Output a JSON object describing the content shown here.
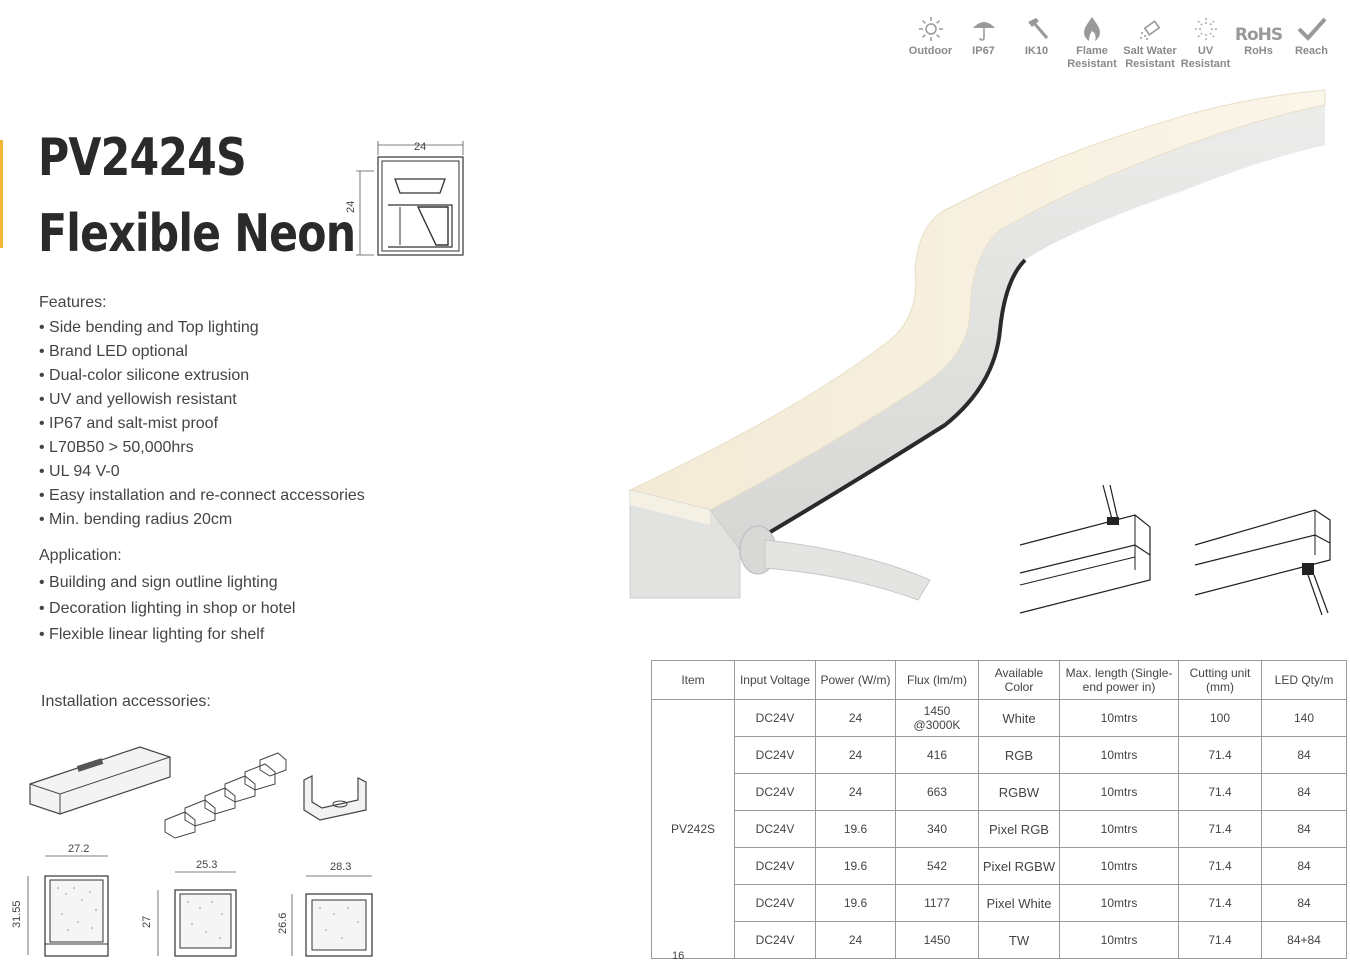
{
  "header": {
    "title_line1": "PV2424S",
    "title_line2": "Flexible Neon"
  },
  "cross_section": {
    "width_label": "24",
    "height_label": "24"
  },
  "certifications": [
    {
      "name": "sun-icon",
      "label": "Outdoor"
    },
    {
      "name": "umbrella-icon",
      "label": "IP67"
    },
    {
      "name": "hammer-icon",
      "label": "IK10"
    },
    {
      "name": "flame-icon",
      "label": "Flame Resistant"
    },
    {
      "name": "salt-spray-icon",
      "label": "Salt Water Resistant"
    },
    {
      "name": "uv-icon",
      "label": "UV Resistant"
    },
    {
      "name": "rohs-icon",
      "label": "RoHs",
      "glyph": "RoHS"
    },
    {
      "name": "checkmark-icon",
      "label": "Reach"
    }
  ],
  "features": {
    "heading": "Features:",
    "items": [
      "Side bending and Top lighting",
      "Brand LED optional",
      "Dual-color silicone extrusion",
      "UV and yellowish resistant",
      "IP67 and salt-mist proof",
      "L70B50 > 50,000hrs",
      "UL 94 V-0",
      "Easy installation and re-connect accessories",
      "Min. bending radius 20cm"
    ]
  },
  "application": {
    "heading": "Application:",
    "items": [
      "Building and sign outline lighting",
      "Decoration lighting in shop or hotel",
      "Flexible linear lighting for shelf"
    ]
  },
  "accessories": {
    "heading": "Installation accessories:",
    "profiles": [
      {
        "width": "27.2",
        "height": "31.55"
      },
      {
        "width": "25.3",
        "height": "27"
      },
      {
        "width": "28.3",
        "height": "26.6"
      }
    ]
  },
  "spec_table": {
    "headers": [
      "Item",
      "Input Voltage",
      "Power (W/m)",
      "Flux (lm/m)",
      "Available Color",
      "Max. length (Single-end power in)",
      "Cutting unit (mm)",
      "LED Qty/m"
    ],
    "item": "PV242S",
    "rows": [
      {
        "voltage": "DC24V",
        "power": "24",
        "flux": "1450 @3000K",
        "color": "White",
        "length": "10mtrs",
        "cut": "100",
        "qty": "140"
      },
      {
        "voltage": "DC24V",
        "power": "24",
        "flux": "416",
        "color": "RGB",
        "length": "10mtrs",
        "cut": "71.4",
        "qty": "84"
      },
      {
        "voltage": "DC24V",
        "power": "24",
        "flux": "663",
        "color": "RGBW",
        "length": "10mtrs",
        "cut": "71.4",
        "qty": "84"
      },
      {
        "voltage": "DC24V",
        "power": "19.6",
        "flux": "340",
        "color": "Pixel RGB",
        "length": "10mtrs",
        "cut": "71.4",
        "qty": "84"
      },
      {
        "voltage": "DC24V",
        "power": "19.6",
        "flux": "542",
        "color": "Pixel RGBW",
        "length": "10mtrs",
        "cut": "71.4",
        "qty": "84"
      },
      {
        "voltage": "DC24V",
        "power": "19.6",
        "flux": "1177",
        "color": "Pixel White",
        "length": "10mtrs",
        "cut": "71.4",
        "qty": "84"
      },
      {
        "voltage": "DC24V",
        "power": "24",
        "flux": "1450",
        "color": "TW",
        "length": "10mtrs",
        "cut": "71.4",
        "qty": "84+84"
      }
    ]
  },
  "page_number": "16",
  "colors": {
    "accent": "#f2b632",
    "glow": "#f7efdc",
    "body": "#e6e6e4"
  }
}
